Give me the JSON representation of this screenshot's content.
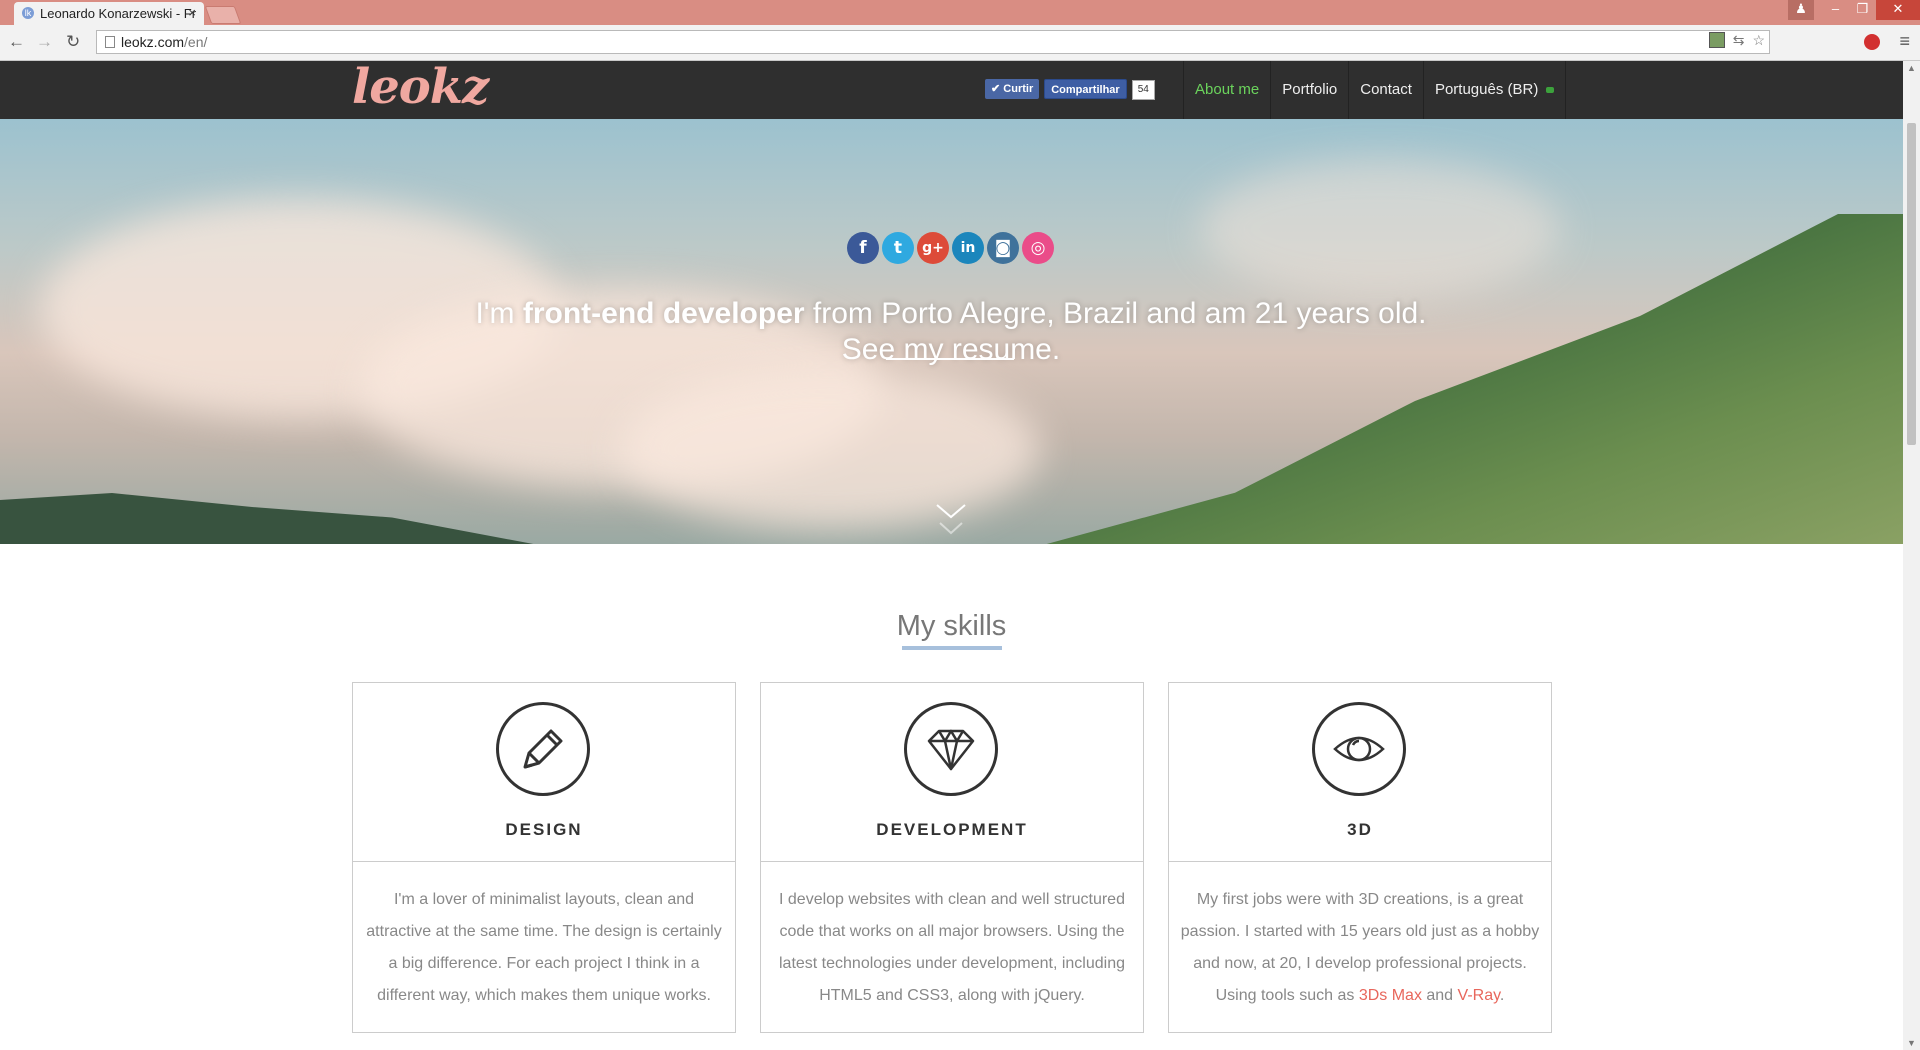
{
  "browser": {
    "tab_title": "Leonardo Konarzewski - Fr",
    "tab_close": "×",
    "url_host": "leokz.com",
    "url_path": "/en/"
  },
  "site": {
    "logo": "leokz",
    "social": {
      "like_label": "Curtir",
      "share_label": "Compartilhar",
      "count": "54"
    },
    "nav": [
      {
        "label": "About me",
        "active": true
      },
      {
        "label": "Portfolio"
      },
      {
        "label": "Contact"
      },
      {
        "label": "Português (BR)"
      }
    ]
  },
  "hero": {
    "social_icons": [
      {
        "name": "facebook-icon",
        "glyph": "f",
        "color": "#3b5998"
      },
      {
        "name": "twitter-icon",
        "glyph": "t",
        "color": "#2fa9e0"
      },
      {
        "name": "google-plus-icon",
        "glyph": "g+",
        "color": "#dd4b39"
      },
      {
        "name": "linkedin-icon",
        "glyph": "in",
        "color": "#1b86bc"
      },
      {
        "name": "instagram-icon",
        "glyph": "◙",
        "color": "#3f729b"
      },
      {
        "name": "dribbble-icon",
        "glyph": "◎",
        "color": "#ea4c89"
      }
    ],
    "text_pre": "I'm ",
    "text_bold1": "front-end developer",
    "text_mid": " from Porto Alegre, Brazil and am 21 years old. See my ",
    "text_link": "resume",
    "text_end": "."
  },
  "skills": {
    "title": "My skills",
    "cards": [
      {
        "title": "DESIGN",
        "icon": "pencil-icon",
        "text": "I'm a lover of minimalist layouts, clean and attractive at the same time. The design is certainly a big difference. For each project I think in a different way, which makes them unique works."
      },
      {
        "title": "DEVELOPMENT",
        "icon": "diamond-icon",
        "text": "I develop websites with clean and well structured code that works on all major browsers. Using the latest technologies under development, including HTML5 and CSS3, along with jQuery."
      },
      {
        "title": "3D",
        "icon": "eye-icon",
        "text_pre": "My first jobs were with 3D creations, is a great passion. I started with 15 years old just as a hobby and now, at 20, I develop professional projects. Using tools such as ",
        "tool1": "3Ds Max",
        "text_and": " and ",
        "tool2": "V-Ray",
        "text_end": "."
      }
    ]
  },
  "colors": {
    "titlebar": "#d98d83",
    "nav_active": "#6bd35c",
    "link_highlight": "#e8675c",
    "skills_accent": "#a7c0dc"
  }
}
